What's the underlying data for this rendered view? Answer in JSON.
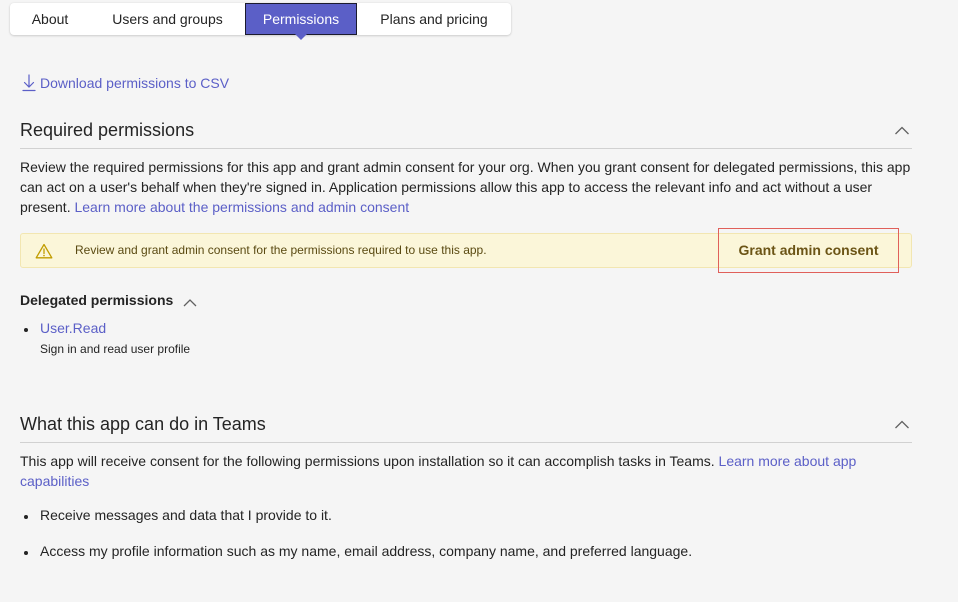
{
  "tabs": [
    {
      "label": "About",
      "active": false
    },
    {
      "label": "Users and groups",
      "active": false
    },
    {
      "label": "Permissions",
      "active": true
    },
    {
      "label": "Plans and pricing",
      "active": false
    }
  ],
  "download_link": "Download permissions to CSV",
  "required_section": {
    "title": "Required permissions",
    "description": "Review the required permissions for this app and grant admin consent for your org. When you grant consent for delegated permissions, this app can act on a user's behalf when they're signed in. Application permissions allow this app to access the relevant info and act without a user present.",
    "learn_more_link": "Learn more about the permissions and admin consent"
  },
  "warning": {
    "text": "Review and grant admin consent for the permissions required to use this app.",
    "button_label": "Grant admin consent"
  },
  "delegated": {
    "title": "Delegated permissions",
    "items": [
      {
        "name": "User.Read",
        "description": "Sign in and read user profile"
      }
    ]
  },
  "teams_section": {
    "title": "What this app can do in Teams",
    "description": "This app will receive consent for the following permissions upon installation so it can accomplish tasks in Teams.",
    "learn_more_link": "Learn more about app capabilities",
    "capabilities": [
      "Receive messages and data that I provide to it.",
      "Access my profile information such as my name, email address, company name, and preferred language."
    ]
  },
  "colors": {
    "accent": "#5b5fc7",
    "warning_bg": "#fbf6d9",
    "highlight_border": "#e0605a"
  }
}
